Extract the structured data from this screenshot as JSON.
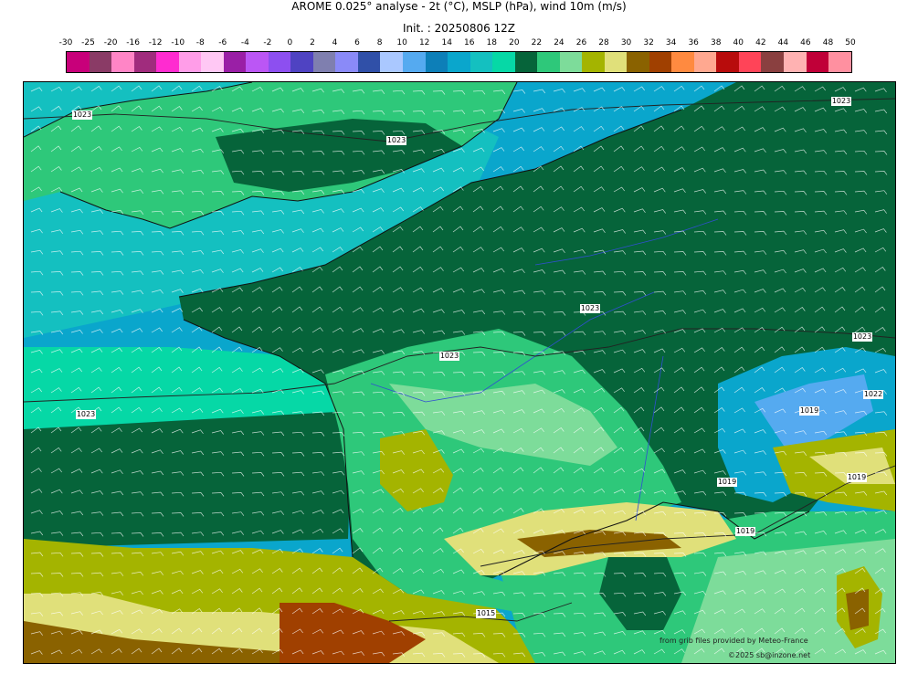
{
  "header": {
    "title": "AROME 0.025° analyse - 2t (°C), MSLP (hPa), wind 10m (m/s)",
    "init": "Init. : 20250806 12Z"
  },
  "colorbar": {
    "ticks": [
      "-30",
      "-25",
      "-20",
      "-16",
      "-12",
      "-10",
      "-8",
      "-6",
      "-4",
      "-2",
      "0",
      "2",
      "4",
      "6",
      "8",
      "10",
      "12",
      "14",
      "16",
      "18",
      "20",
      "22",
      "24",
      "26",
      "28",
      "30",
      "32",
      "34",
      "36",
      "38",
      "40",
      "42",
      "44",
      "46",
      "48",
      "50"
    ],
    "colors": [
      "#c8007a",
      "#8a3b66",
      "#ff85c6",
      "#a02c7d",
      "#ff2bd0",
      "#ff9de8",
      "#ffc8f4",
      "#9a1fa6",
      "#bb56f5",
      "#8d4ff0",
      "#4f43c2",
      "#7f7faf",
      "#8a8af8",
      "#3050a8",
      "#aac8ff",
      "#55aaf0",
      "#0d7fb8",
      "#0aa6cc",
      "#14c0c0",
      "#06d8a6",
      "#06643a",
      "#2ec87a",
      "#7ddc9a",
      "#a4b400",
      "#e0e07a",
      "#8a6200",
      "#a04000",
      "#ff8a40",
      "#ffa890",
      "#b80c0c",
      "#ff4458",
      "#8a4040",
      "#ffb2b2",
      "#c00038",
      "#ff90a0"
    ]
  },
  "map": {
    "isobar_labels": [
      "1023",
      "1023",
      "1023",
      "1023",
      "1023",
      "1023",
      "1022",
      "1019",
      "1019",
      "1019",
      "1019",
      "1015",
      "1023"
    ]
  },
  "credits": {
    "source": "from grib files provided by Meteo-France",
    "copyright": "©2025 sb@inzone.net"
  }
}
